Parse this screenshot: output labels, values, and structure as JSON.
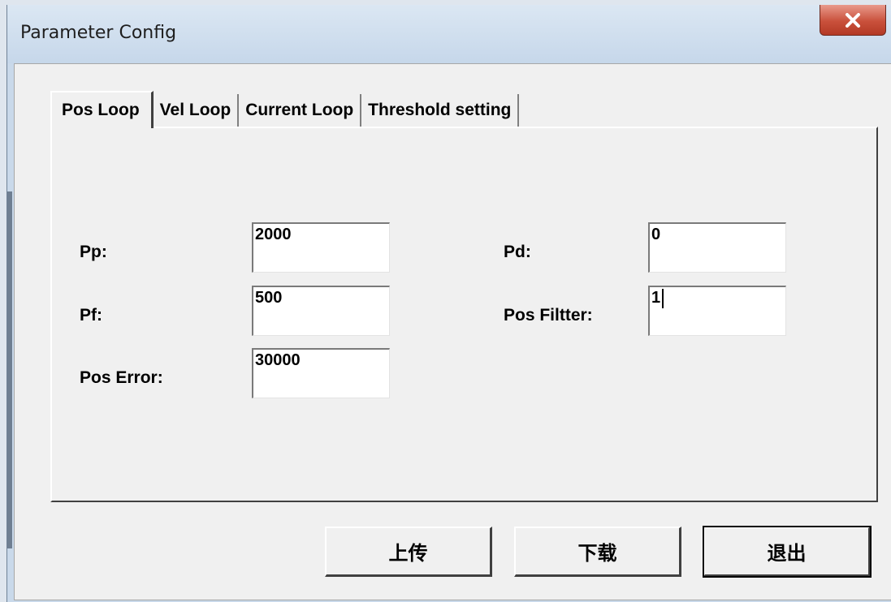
{
  "window": {
    "title": "Parameter Config",
    "close_symbol": "×"
  },
  "tabs": [
    {
      "label": "Pos Loop",
      "active": true
    },
    {
      "label": "Vel Loop",
      "active": false
    },
    {
      "label": "Current Loop",
      "active": false
    },
    {
      "label": "Threshold setting",
      "active": false
    }
  ],
  "fields": {
    "pp": {
      "label": "Pp:",
      "value": "2000"
    },
    "pf": {
      "label": "Pf:",
      "value": "500"
    },
    "pos_error": {
      "label": "Pos Error:",
      "value": "30000"
    },
    "pd": {
      "label": "Pd:",
      "value": "0"
    },
    "pos_filter": {
      "label": "Pos Filtter:",
      "value": "1"
    }
  },
  "buttons": {
    "upload": "上传",
    "download": "下载",
    "exit": "退出"
  },
  "icons": {
    "close": "close-icon"
  }
}
